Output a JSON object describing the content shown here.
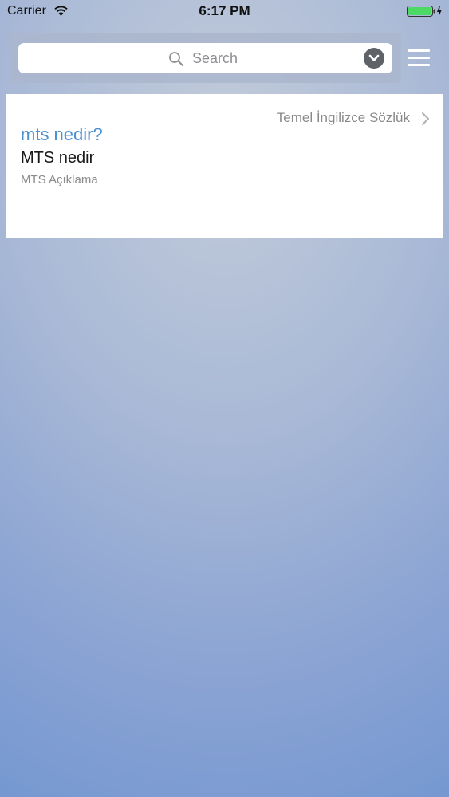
{
  "status_bar": {
    "carrier": "Carrier",
    "time": "6:17 PM",
    "battery_color": "#4cd964"
  },
  "search": {
    "placeholder": "Search",
    "icon": "search-icon",
    "dropdown_icon": "chevron-down-icon"
  },
  "menu": {
    "icon": "hamburger-menu-icon"
  },
  "result": {
    "query": "mts nedir?",
    "source": "Temel İngilizce Sözlük",
    "term": "MTS nedir",
    "definition": "MTS Açıklama",
    "query_color": "#4a8fd0"
  }
}
